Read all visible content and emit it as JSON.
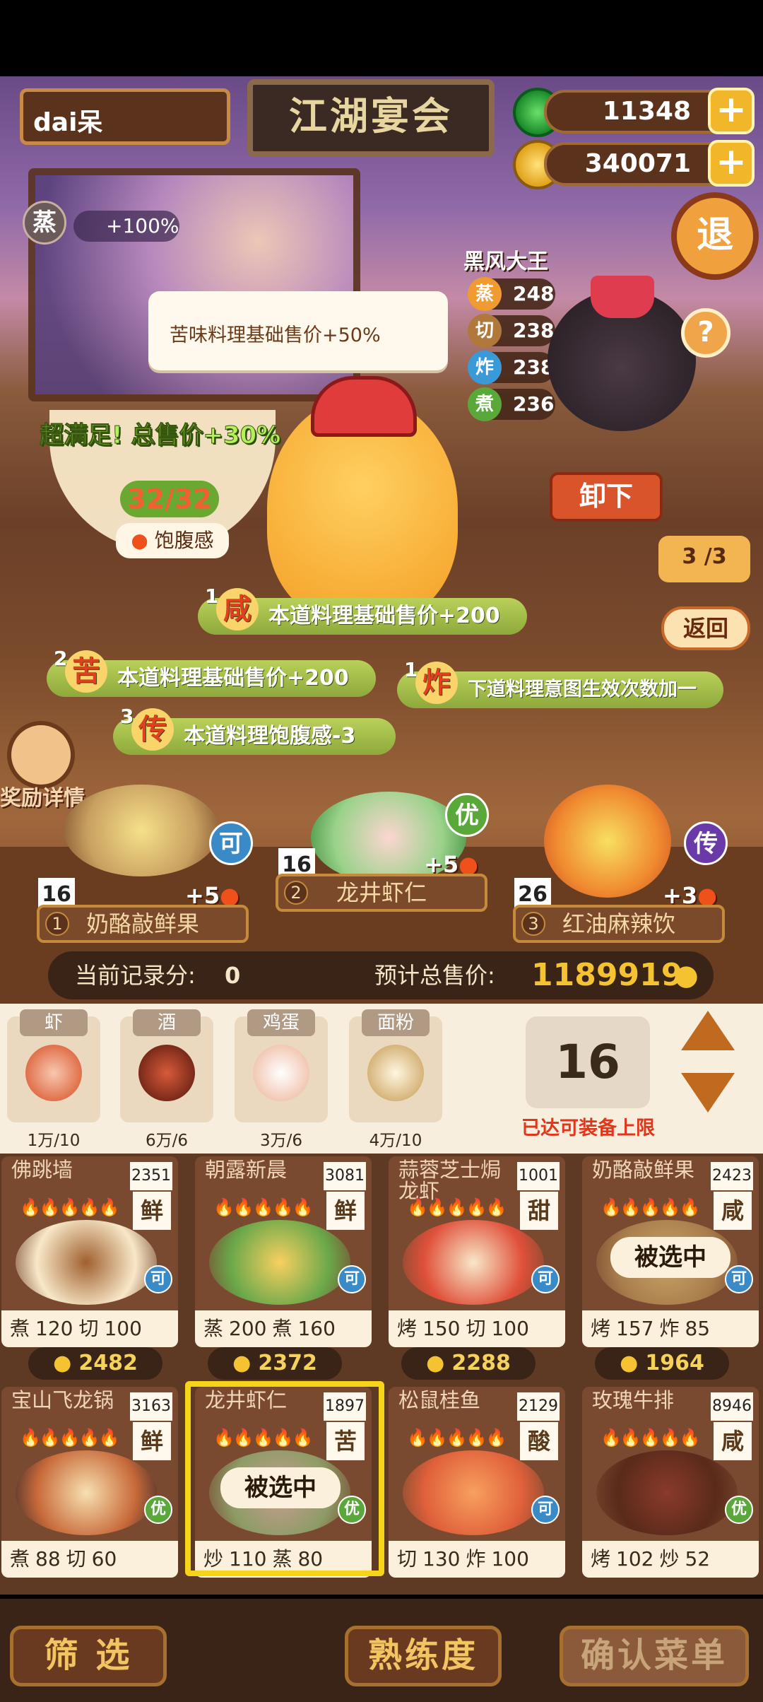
{
  "header": {
    "player_name": "dai呆",
    "title": "江湖宴会",
    "jade": "11348",
    "coins": "340071",
    "plus": "+",
    "quit_label": "退"
  },
  "buff": {
    "icon_glyph": "蒸",
    "value": "+100%"
  },
  "tooltip": "苦味料理基础售价+50%",
  "satisfaction": {
    "label": "超满足!  总售价+30%",
    "count": "32/32",
    "satiety_label": "饱腹感"
  },
  "opponent": {
    "name": "黑风大王",
    "stats": [
      {
        "glyph": "蒸",
        "value": "248",
        "color": "#f09a32"
      },
      {
        "glyph": "切",
        "value": "238",
        "color": "#b0783a"
      },
      {
        "glyph": "炸",
        "value": "238",
        "color": "#3a9ad8"
      },
      {
        "glyph": "煮",
        "value": "236",
        "color": "#5aa83a"
      }
    ],
    "help": "?"
  },
  "controls": {
    "unload": "卸下",
    "round": "3 /3",
    "back": "返回"
  },
  "effects": [
    {
      "num": "1",
      "glyph": "咸",
      "text": "本道料理基础售价+200"
    },
    {
      "num": "2",
      "glyph": "苦",
      "text": "本道料理基础售价+200"
    },
    {
      "num": "1",
      "glyph": "炸",
      "text": "下道料理意图生效次数加一"
    },
    {
      "num": "3",
      "glyph": "传",
      "text": "本道料理饱腹感-3"
    }
  ],
  "reward_label": "奖励详情",
  "dishes": [
    {
      "rank": "16",
      "tier": "可",
      "sat": "+5",
      "idx": "1",
      "name": "奶酪敲鲜果",
      "tier_color": "#3a8ac8"
    },
    {
      "rank": "16",
      "tier": "优",
      "sat": "+5",
      "idx": "2",
      "name": "龙井虾仁",
      "tier_color": "#5aa83a"
    },
    {
      "rank": "26",
      "tier": "传",
      "sat": "+3",
      "idx": "3",
      "name": "红油麻辣饮",
      "tier_color": "#6a3aa8"
    }
  ],
  "score": {
    "record_label": "当前记录分:",
    "record_value": "0",
    "total_label": "预计总售价:",
    "total_value": "1189919"
  },
  "ingredients": [
    {
      "name": "虾",
      "count": "1万/10"
    },
    {
      "name": "酒",
      "count": "6万/6"
    },
    {
      "name": "鸡蛋",
      "count": "3万/6"
    },
    {
      "name": "面粉",
      "count": "4万/10"
    }
  ],
  "equip": {
    "count": "16",
    "note": "已达可装备上限"
  },
  "recipes_top": [
    {
      "name": "佛跳墙",
      "price": "2351",
      "taste": "鲜",
      "tier": "可",
      "s1": "煮",
      "v1": "120",
      "s2": "切",
      "v2": "100",
      "coin": "2482",
      "tier_color": "#3a8ac8"
    },
    {
      "name": "朝露新晨",
      "price": "3081",
      "taste": "鲜",
      "tier": "可",
      "s1": "蒸",
      "v1": "200",
      "s2": "煮",
      "v2": "160",
      "coin": "2372",
      "tier_color": "#3a8ac8"
    },
    {
      "name": "蒜蓉芝士焗龙虾",
      "price": "1001",
      "taste": "甜",
      "tier": "可",
      "s1": "烤",
      "v1": "150",
      "s2": "切",
      "v2": "100",
      "coin": "2288",
      "tier_color": "#3a8ac8"
    },
    {
      "name": "奶酪敲鲜果",
      "price": "2423",
      "taste": "咸",
      "tier": "可",
      "s1": "烤",
      "v1": "157",
      "s2": "炸",
      "v2": "85",
      "coin": "1964",
      "tier_color": "#3a8ac8",
      "selected": "被选中"
    }
  ],
  "recipes_bottom": [
    {
      "name": "宝山飞龙锅",
      "price": "3163",
      "taste": "鲜",
      "tier": "优",
      "s1": "煮",
      "v1": "88",
      "s2": "切",
      "v2": "60",
      "tier_color": "#5aa83a"
    },
    {
      "name": "龙井虾仁",
      "price": "1897",
      "taste": "苦",
      "tier": "优",
      "s1": "炒",
      "v1": "110",
      "s2": "蒸",
      "v2": "80",
      "tier_color": "#5aa83a",
      "selected": "被选中"
    },
    {
      "name": "松鼠桂鱼",
      "price": "2129",
      "taste": "酸",
      "tier": "可",
      "s1": "切",
      "v1": "130",
      "s2": "炸",
      "v2": "100",
      "tier_color": "#3a8ac8"
    },
    {
      "name": "玫瑰牛排",
      "price": "8946",
      "taste": "咸",
      "tier": "优",
      "s1": "烤",
      "v1": "102",
      "s2": "炒",
      "v2": "52",
      "tier_color": "#5aa83a"
    }
  ],
  "flames": "🔥🔥🔥🔥🔥",
  "bottom": {
    "filter": "筛 选",
    "proficiency": "熟练度",
    "confirm": "确认菜单"
  }
}
